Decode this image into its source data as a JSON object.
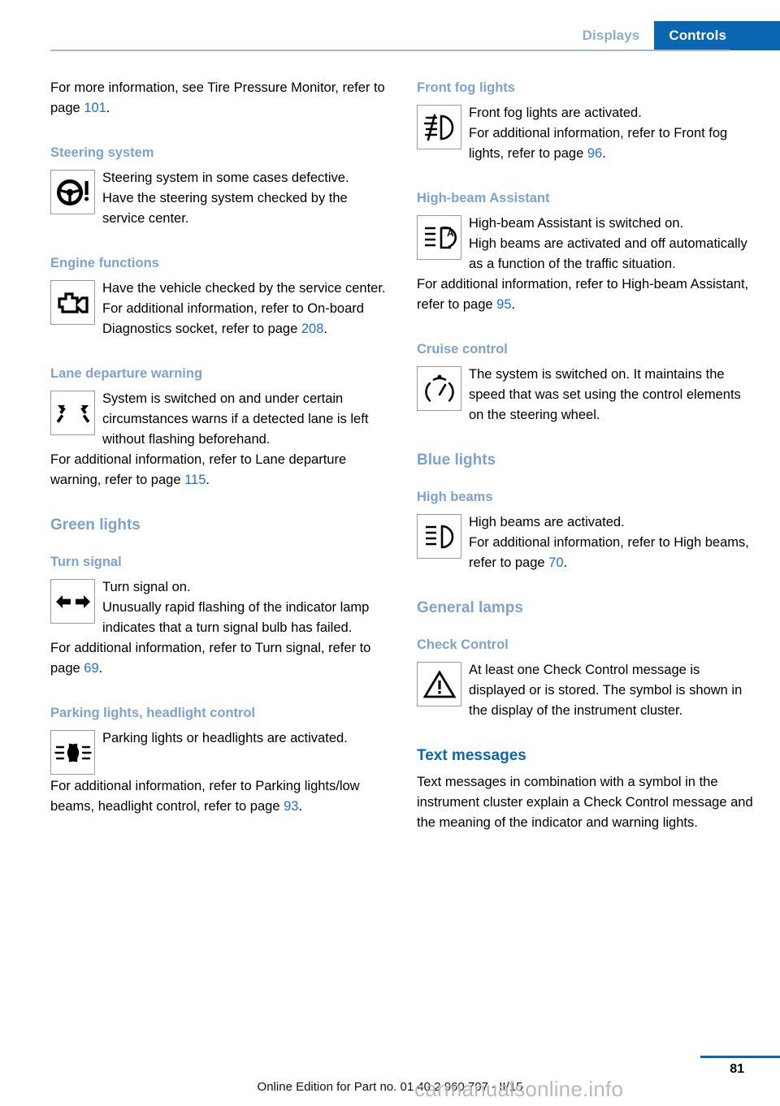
{
  "header": {
    "tabs": [
      {
        "label": "Displays",
        "active": false
      },
      {
        "label": "Controls",
        "active": true
      }
    ],
    "accent_active_bg": "#0a66b0",
    "accent_inactive_text": "#8fadd4",
    "rule_color": "#9fb8da"
  },
  "left_column": {
    "intro": {
      "text_before": "For more information, see Tire Pressure Monitor, refer to page ",
      "page": "101",
      "text_after": "."
    },
    "steering": {
      "heading": "Steering system",
      "icon": "steering-wheel-warning-icon",
      "line1": "Steering system in some cases defective.",
      "line2": "Have the steering system checked by the service center."
    },
    "engine": {
      "heading": "Engine functions",
      "icon": "check-engine-icon",
      "line1": "Have the vehicle checked by the service center.",
      "line2_before": "For additional information, refer to On-board Diagnostics socket, refer to page ",
      "line2_page": "208",
      "line2_after": "."
    },
    "lane": {
      "heading": "Lane departure warning",
      "icon": "lane-departure-warning-icon",
      "line1": "System is switched on and under certain circumstances warns if a detected lane is left without flashing beforehand.",
      "line2_before": "For additional information, refer to Lane departure warning, refer to page ",
      "line2_page": "115",
      "line2_after": "."
    },
    "green_lights": {
      "heading": "Green lights"
    },
    "turn_signal": {
      "heading": "Turn signal",
      "icon": "turn-signal-arrows-icon",
      "line1": "Turn signal on.",
      "line2": "Unusually rapid flashing of the indicator lamp indicates that a turn signal bulb has failed.",
      "line3_before": "For additional information, refer to Turn signal, refer to page ",
      "line3_page": "69",
      "line3_after": "."
    },
    "parking": {
      "heading": "Parking lights, headlight control",
      "icon": "parking-lights-icon",
      "line1": "Parking lights or headlights are activated.",
      "line2_before": "For additional information, refer to Parking lights/low beams, headlight control, refer to page ",
      "line2_page": "93",
      "line2_after": "."
    }
  },
  "right_column": {
    "front_fog": {
      "heading": "Front fog lights",
      "icon": "front-fog-light-icon",
      "line1": "Front fog lights are activated.",
      "line2_before": "For additional information, refer to Front fog lights, refer to page ",
      "line2_page": "96",
      "line2_after": "."
    },
    "high_beam_assistant": {
      "heading": "High-beam Assistant",
      "icon": "high-beam-assistant-icon",
      "line1": "High-beam Assistant is switched on.",
      "line2": "High beams are activated and off automatically as a function of the traffic situation.",
      "line3_before": "For additional information, refer to High-beam Assistant, refer to page ",
      "line3_page": "95",
      "line3_after": "."
    },
    "cruise": {
      "heading": "Cruise control",
      "icon": "cruise-control-speedometer-icon",
      "line1": "The system is switched on. It maintains the speed that was set using the control elements on the steering wheel."
    },
    "blue_lights": {
      "heading": "Blue lights"
    },
    "high_beams": {
      "heading": "High beams",
      "icon": "high-beam-icon",
      "line1": "High beams are activated.",
      "line2_before": "For additional information, refer to High beams, refer to page ",
      "line2_page": "70",
      "line2_after": "."
    },
    "general_lamps": {
      "heading": "General lamps"
    },
    "check_control": {
      "heading": "Check Control",
      "icon": "warning-triangle-icon",
      "line1": "At least one Check Control message is displayed or is stored. The symbol is shown in the display of the instrument cluster."
    },
    "text_messages": {
      "heading": "Text messages",
      "body": "Text messages in combination with a symbol in the instrument cluster explain a Check Control message and the meaning of the indicator and warning lights."
    }
  },
  "footer": {
    "page_number": "81",
    "edition": "Online Edition for Part no. 01 40 2 960 707 - II/15",
    "watermark": "carmanualsonline.info",
    "rule_color": "#0a66b0"
  }
}
